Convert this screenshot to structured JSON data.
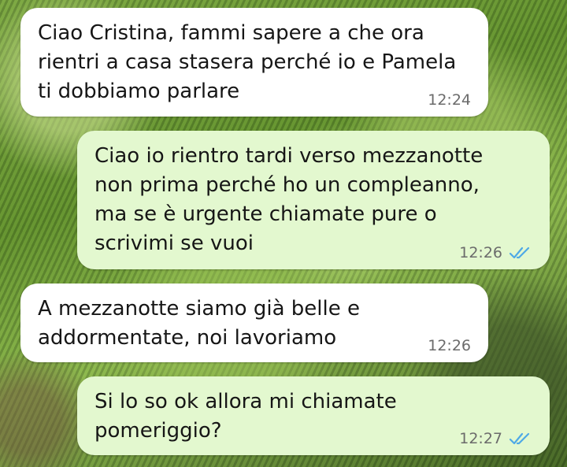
{
  "messages": [
    {
      "direction": "incoming",
      "text": "Ciao Cristina, fammi sapere a che ora\nrientri a casa stasera perché io e Pamela\nti dobbiamo parlare",
      "time": "12:24"
    },
    {
      "direction": "outgoing",
      "text": "Ciao io rientro tardi verso mezzanotte\nnon prima perché ho un compleanno,\nma se è urgente chiamate pure o\nscrivimi se vuoi",
      "time": "12:26",
      "status": "read-double-check-icon"
    },
    {
      "direction": "incoming",
      "text": "A mezzanotte siamo già belle e\naddormentate, noi lavoriamo",
      "time": "12:26"
    },
    {
      "direction": "outgoing",
      "text": "Si lo so ok allora mi chiamate\npomeriggio?",
      "time": "12:27",
      "status": "read-double-check-icon"
    }
  ],
  "colors": {
    "incoming_bubble": "#ffffff",
    "outgoing_bubble": "#e3f8cf",
    "read_ticks": "#4fa9e6",
    "timestamp": "#6b6b6b"
  }
}
